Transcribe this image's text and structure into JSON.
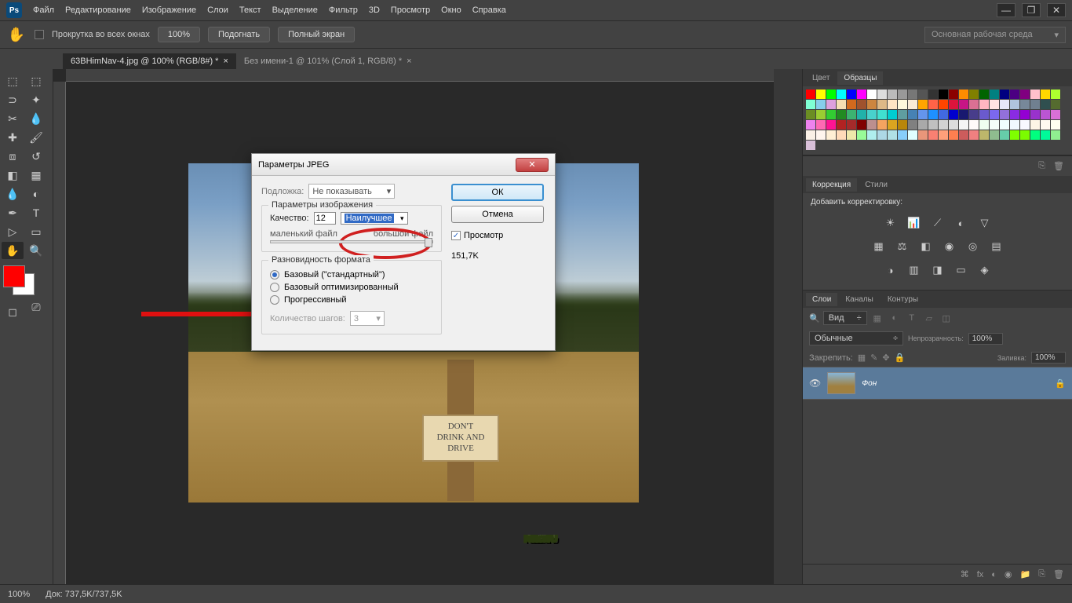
{
  "menu": [
    "Файл",
    "Редактирование",
    "Изображение",
    "Слои",
    "Текст",
    "Выделение",
    "Фильтр",
    "3D",
    "Просмотр",
    "Окно",
    "Справка"
  ],
  "options": {
    "scroll_all": "Прокрутка во всех окнах",
    "zoom_100": "100%",
    "fit": "Подогнать",
    "fullscreen": "Полный экран",
    "workspace": "Основная рабочая среда"
  },
  "tabs": [
    {
      "title": "63BHimNav-4.jpg @ 100% (RGB/8#) *",
      "active": true
    },
    {
      "title": "Без имени-1 @ 101% (Слой 1, RGB/8) *",
      "active": false
    }
  ],
  "dialog": {
    "title": "Параметры JPEG",
    "matte_label": "Подложка:",
    "matte_value": "Не показывать",
    "params_legend": "Параметры изображения",
    "quality_label": "Качество:",
    "quality_value": "12",
    "quality_preset": "Наилучшее",
    "small_file": "маленький файл",
    "big_file": "большой файл",
    "format_legend": "Разновидность формата",
    "baseline": "Базовый (\"стандартный\")",
    "baseline_opt": "Базовый оптимизированный",
    "progressive": "Прогрессивный",
    "steps_label": "Количество шагов:",
    "steps_value": "3",
    "ok": "ОК",
    "cancel": "Отмена",
    "preview": "Просмотр",
    "filesize": "151,7K"
  },
  "sign": "DON'T\nDRINK AND\nDRIVE",
  "panels": {
    "color_tab": "Цвет",
    "swatches_tab": "Образцы",
    "corrections_tab": "Коррекция",
    "styles_tab": "Стили",
    "add_correction": "Добавить корректировку:",
    "layers_tab": "Слои",
    "channels_tab": "Каналы",
    "paths_tab": "Контуры",
    "filter_kind": "Вид",
    "blend_mode": "Обычные",
    "opacity_label": "Непрозрачность:",
    "opacity_value": "100%",
    "lock_label": "Закрепить:",
    "fill_label": "Заливка:",
    "fill_value": "100%",
    "layer_name": "Фон"
  },
  "status": {
    "zoom": "100%",
    "doc": "Док: 737,5K/737,5K"
  },
  "watermark": "PS-BLOG.RU",
  "swatch_colors": [
    "#ff0000",
    "#ffff00",
    "#00ff00",
    "#00ffff",
    "#0000ff",
    "#ff00ff",
    "#ffffff",
    "#dddddd",
    "#bbbbbb",
    "#999999",
    "#777777",
    "#555555",
    "#333333",
    "#000000",
    "#8b0000",
    "#ff8c00",
    "#808000",
    "#006400",
    "#008080",
    "#000080",
    "#4b0082",
    "#800080",
    "#ffc0cb",
    "#ffd700",
    "#adff2f",
    "#7fffd4",
    "#87ceeb",
    "#dda0dd",
    "#f5deb3",
    "#d2691e",
    "#a0522d",
    "#cd853f",
    "#deb887",
    "#ffe4c4",
    "#fff8dc",
    "#faebd7",
    "#ffa500",
    "#ff6347",
    "#ff4500",
    "#dc143c",
    "#c71585",
    "#db7093",
    "#ffb6c1",
    "#ffe4e1",
    "#e6e6fa",
    "#b0c4de",
    "#778899",
    "#708090",
    "#2f4f4f",
    "#556b2f",
    "#6b8e23",
    "#9acd32",
    "#32cd32",
    "#228b22",
    "#3cb371",
    "#20b2aa",
    "#48d1cc",
    "#40e0d0",
    "#00ced1",
    "#5f9ea0",
    "#4682b4",
    "#6495ed",
    "#1e90ff",
    "#4169e1",
    "#0000cd",
    "#191970",
    "#483d8b",
    "#6a5acd",
    "#7b68ee",
    "#9370db",
    "#8a2be2",
    "#9400d3",
    "#9932cc",
    "#ba55d3",
    "#da70d6",
    "#ee82ee",
    "#ff69b4",
    "#ff1493",
    "#b22222",
    "#a52a2a",
    "#800000",
    "#bc8f8f",
    "#f4a460",
    "#daa520",
    "#b8860b",
    "#808080",
    "#a9a9a9",
    "#c0c0c0",
    "#d3d3d3",
    "#dcdcdc",
    "#f5f5f5",
    "#fffafa",
    "#f0fff0",
    "#f5fffa",
    "#f0ffff",
    "#f0f8ff",
    "#f8f8ff",
    "#fdf5e6",
    "#fffaf0",
    "#fffff0",
    "#faf0e6",
    "#fff5ee",
    "#ffefd5",
    "#ffdab9",
    "#eee8aa",
    "#98fb98",
    "#afeeee",
    "#add8e6",
    "#b0e0e6",
    "#87cefa",
    "#e0ffff",
    "#e9967a",
    "#fa8072",
    "#ffa07a",
    "#ff7f50",
    "#cd5c5c",
    "#f08080",
    "#bdb76b",
    "#8fbc8f",
    "#66cdaa",
    "#7fff00",
    "#7cfc00",
    "#00ff7f",
    "#00fa9a",
    "#90ee90",
    "#d8bfd8"
  ]
}
